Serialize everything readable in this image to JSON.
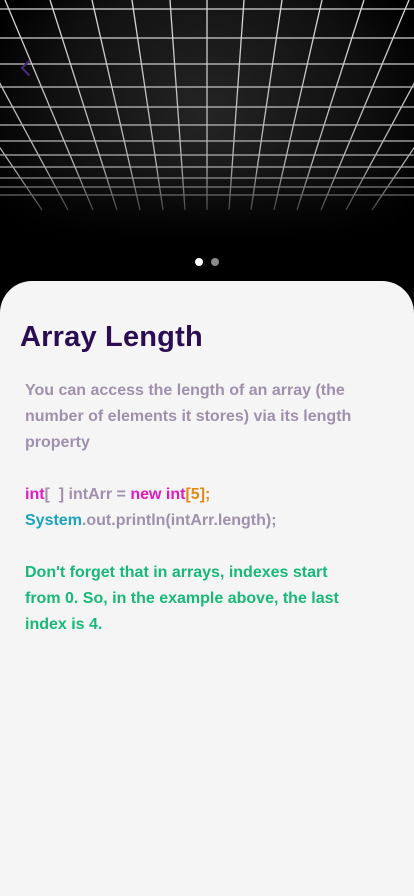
{
  "header": {
    "back_icon": "chevron-left-icon",
    "pager": {
      "count": 2,
      "active_index": 0
    }
  },
  "content": {
    "title": "Array Length",
    "description": "You can access the length of an array (the number of elements it stores) via its length property",
    "code": {
      "line1": {
        "type": "int",
        "brackets": "[  ]",
        "middle": " intArr = ",
        "new_kw": "new",
        "type2": " int",
        "open": "[",
        "size": "5",
        "close": "];"
      },
      "line2": {
        "cls": "System",
        "rest": ".out.println(intArr.length);"
      }
    },
    "note": "Don't forget that in arrays, indexes start from 0. So, in the example above, the last index is 4."
  },
  "colors": {
    "title": "#2a0d52",
    "body_text": "#a090ad",
    "keyword": "#e01bc0",
    "number": "#e08a14",
    "class": "#1aa3bf",
    "note": "#18b879",
    "card_bg": "#f5f5f5",
    "back_icon": "#4b2a7a"
  }
}
